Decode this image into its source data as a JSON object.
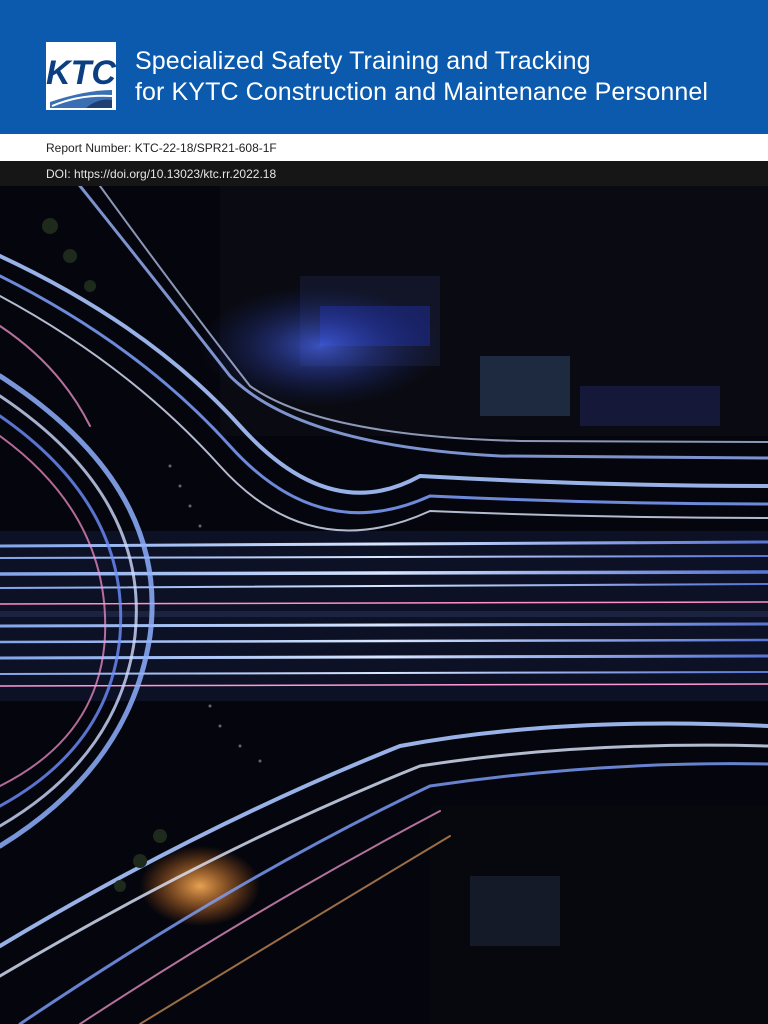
{
  "header": {
    "logo_text": "KTC",
    "title_line1": "Specialized Safety Training and Tracking",
    "title_line2": "for KYTC Construction and Maintenance Personnel"
  },
  "report_number": "Report Number: KTC-22-18/SPR21-608-1F",
  "doi": "DOI: https://doi.org/10.13023/ktc.rr.2022.18",
  "colors": {
    "header_blue": "#0b5aad",
    "doi_bar": "#161616",
    "photo_background": "#05060d"
  }
}
